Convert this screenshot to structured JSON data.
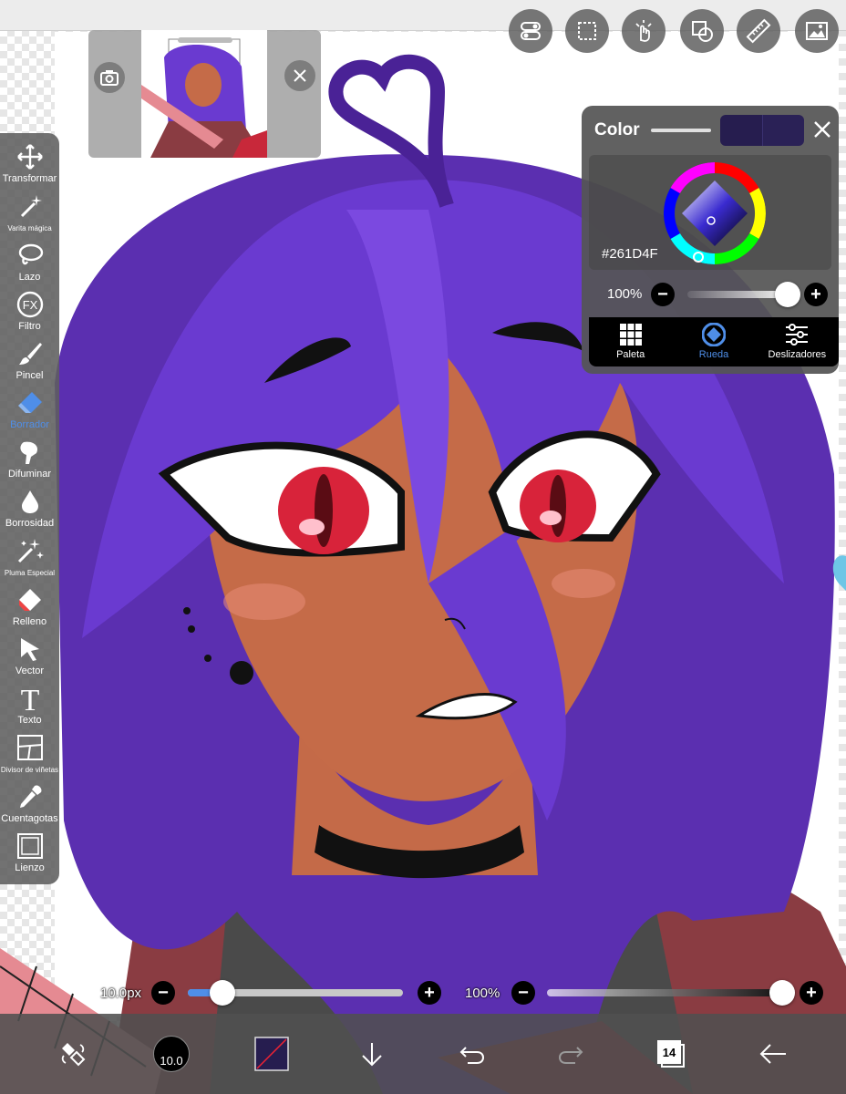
{
  "colors": {
    "accent": "#4f8ee8",
    "current_color": "#261D4F",
    "toolbar_bg": "#5f5f5f",
    "panel_bg": "#555555"
  },
  "toolbar": {
    "items": [
      {
        "label": "Transformar",
        "icon": "move-arrows-icon"
      },
      {
        "label": "Varita mágica",
        "icon": "magic-wand-icon"
      },
      {
        "label": "Lazo",
        "icon": "lasso-icon"
      },
      {
        "label": "Filtro",
        "icon": "fx-icon"
      },
      {
        "label": "Pincel",
        "icon": "brush-icon"
      },
      {
        "label": "Borrador",
        "icon": "eraser-icon",
        "active": true
      },
      {
        "label": "Difuminar",
        "icon": "smudge-icon"
      },
      {
        "label": "Borrosidad",
        "icon": "blur-drop-icon"
      },
      {
        "label": "Pluma Especial",
        "icon": "special-pen-icon"
      },
      {
        "label": "Relleno",
        "icon": "fill-bucket-icon"
      },
      {
        "label": "Vector",
        "icon": "vector-cursor-icon"
      },
      {
        "label": "Texto",
        "icon": "text-icon"
      },
      {
        "label": "Divisor de viñetas",
        "icon": "panel-divider-icon"
      },
      {
        "label": "Cuentagotas",
        "icon": "eyedropper-icon"
      },
      {
        "label": "Lienzo",
        "icon": "canvas-icon"
      }
    ]
  },
  "top_buttons": [
    {
      "icon": "toggle-settings-icon"
    },
    {
      "icon": "selection-icon"
    },
    {
      "icon": "gesture-hand-icon"
    },
    {
      "icon": "shape-icon"
    },
    {
      "icon": "ruler-icon"
    },
    {
      "icon": "gallery-icon"
    }
  ],
  "reference_window": {
    "camera_icon": "camera-icon",
    "close_icon": "close-icon"
  },
  "color_panel": {
    "title": "Color",
    "hex": "#261D4F",
    "opacity": "100%",
    "opacity_value": 1.0,
    "tabs": [
      {
        "label": "Paleta",
        "icon": "palette-grid-icon"
      },
      {
        "label": "Rueda",
        "icon": "color-wheel-icon",
        "active": true
      },
      {
        "label": "Deslizadores",
        "icon": "sliders-icon"
      }
    ]
  },
  "brush_size": {
    "label": "10.0px",
    "value_fraction": 0.16
  },
  "brush_opacity": {
    "label": "100%",
    "value_fraction": 1.0
  },
  "bottom_bar": {
    "brush_size_badge": "10.0",
    "layer_count": "14"
  }
}
